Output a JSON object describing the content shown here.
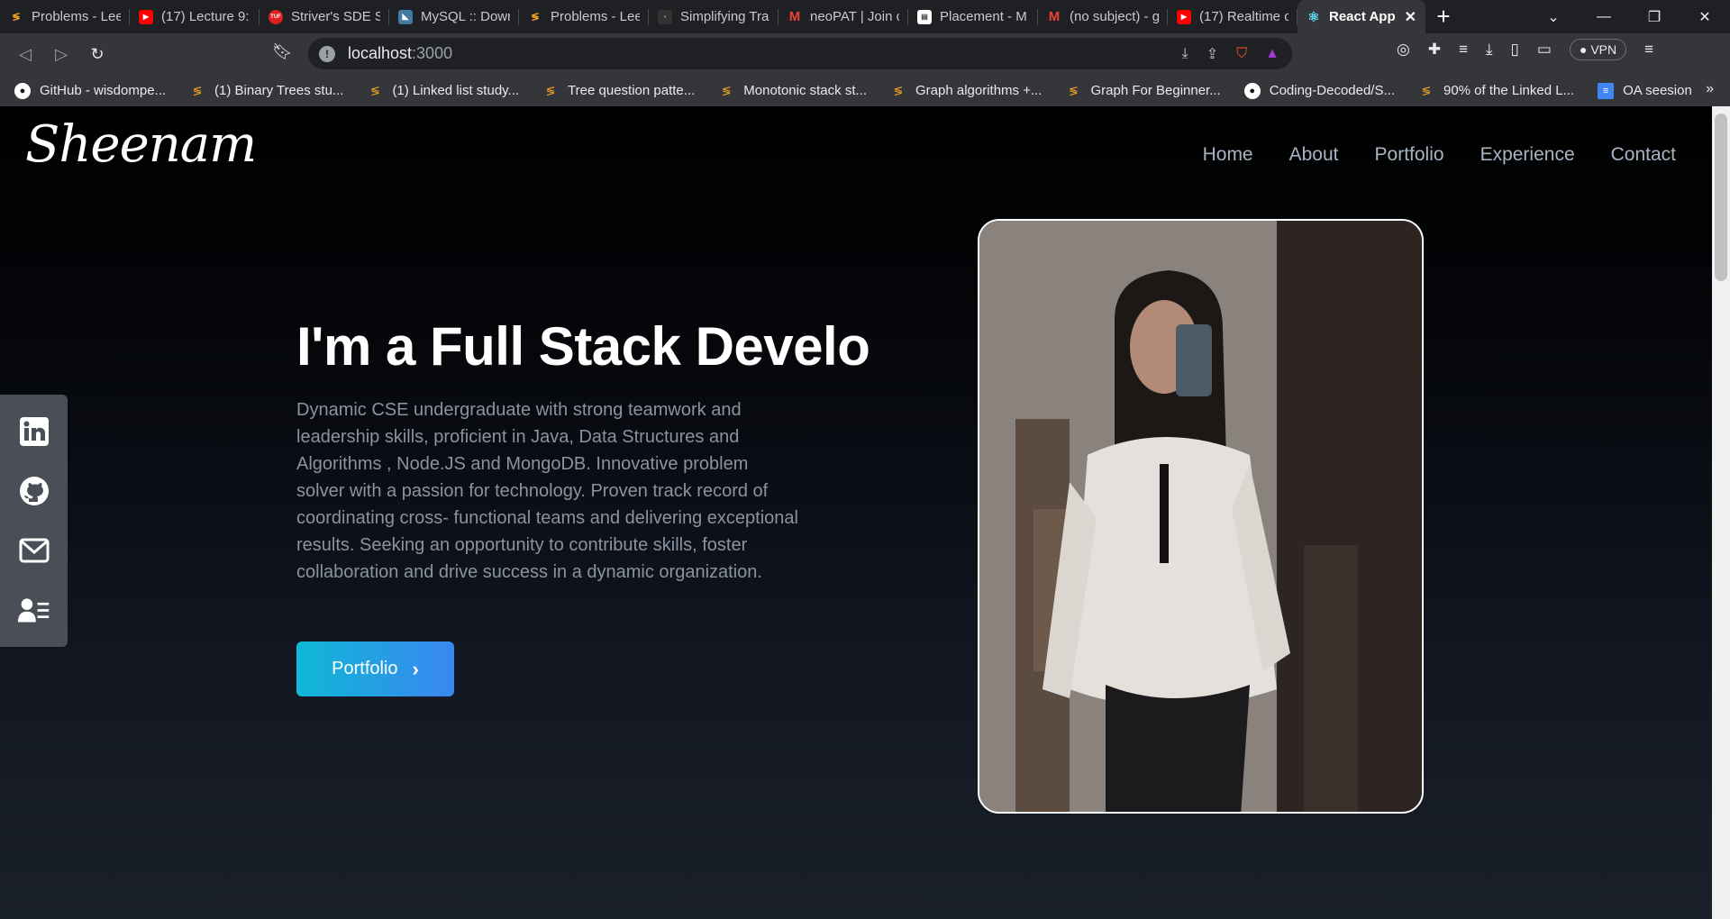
{
  "browser": {
    "tabs": [
      {
        "title": "Problems - Lee",
        "icon": "leetcode-icon",
        "color": "#f5a623"
      },
      {
        "title": "(17) Lecture 9:",
        "icon": "youtube-icon",
        "color": "#ff0000"
      },
      {
        "title": "Striver's SDE S",
        "icon": "tuf-icon",
        "color": "#e02020"
      },
      {
        "title": "MySQL :: Down",
        "icon": "mysql-icon",
        "color": "#4479a1"
      },
      {
        "title": "Problems - Lee",
        "icon": "leetcode-icon",
        "color": "#f5a623"
      },
      {
        "title": "Simplifying Tra",
        "icon": "page-icon",
        "color": "#333333"
      },
      {
        "title": "neoPAT | Join c",
        "icon": "gmail-icon",
        "color": "#ea4335"
      },
      {
        "title": "Placement - M",
        "icon": "doc-icon",
        "color": "#ffffff"
      },
      {
        "title": "(no subject) - g",
        "icon": "gmail-icon",
        "color": "#ea4335"
      },
      {
        "title": "(17) Realtime c",
        "icon": "youtube-icon",
        "color": "#ff0000"
      }
    ],
    "active_tab": {
      "title": "React App",
      "icon": "react-icon"
    },
    "new_tab": "+",
    "url_host": "localhost",
    "url_port": ":3000",
    "vpn_label": "VPN",
    "bookmarks": [
      {
        "label": "GitHub - wisdompe...",
        "icon": "github-icon"
      },
      {
        "label": "(1) Binary Trees stu...",
        "icon": "leetcode-icon"
      },
      {
        "label": "(1) Linked list study...",
        "icon": "leetcode-icon"
      },
      {
        "label": "Tree question patte...",
        "icon": "leetcode-icon"
      },
      {
        "label": "Monotonic stack st...",
        "icon": "leetcode-icon"
      },
      {
        "label": "Graph algorithms +...",
        "icon": "leetcode-icon"
      },
      {
        "label": "Graph For Beginner...",
        "icon": "leetcode-icon"
      },
      {
        "label": "Coding-Decoded/S...",
        "icon": "github-icon"
      },
      {
        "label": "90% of the Linked L...",
        "icon": "leetcode-icon"
      },
      {
        "label": "OA seesion",
        "icon": "doc-icon"
      }
    ],
    "bookmarks_more": "»"
  },
  "site": {
    "logo": "Sheenam",
    "nav": [
      "Home",
      "About",
      "Portfolio",
      "Experience",
      "Contact"
    ],
    "hero_title": "I'm a Full Stack Develo",
    "hero_description": "Dynamic CSE undergraduate with strong teamwork and leadership skills, proficient in Java, Data Structures and Algorithms , Node.JS and MongoDB. Innovative problem solver with a passion for technology. Proven track record of coordinating cross- functional teams and delivering exceptional results. Seeking an opportunity to contribute skills, foster collaboration and drive success in a dynamic organization.",
    "cta_label": "Portfolio",
    "social": [
      "linkedin-icon",
      "github-icon",
      "mail-icon",
      "resume-icon"
    ]
  }
}
